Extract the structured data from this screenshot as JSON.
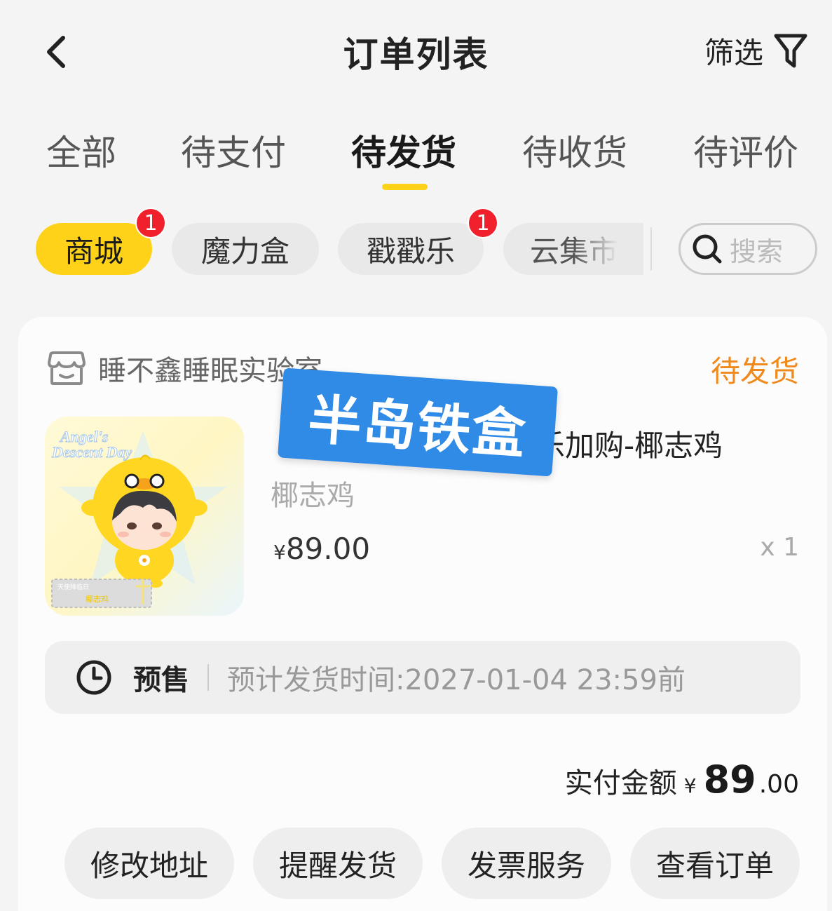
{
  "header": {
    "title": "订单列表",
    "filter_label": "筛选"
  },
  "tabs": [
    {
      "label": "全部"
    },
    {
      "label": "待支付"
    },
    {
      "label": "待发货"
    },
    {
      "label": "待收货"
    },
    {
      "label": "待评价"
    }
  ],
  "active_tab": "待发货",
  "subtabs": [
    {
      "label": "商城",
      "badge": "1"
    },
    {
      "label": "魔力盒"
    },
    {
      "label": "戳戳乐",
      "badge": "1"
    },
    {
      "label": "云集市"
    }
  ],
  "search": {
    "placeholder": "搜索"
  },
  "order": {
    "shop_name": "睡不鑫睡眠实验室",
    "status": "待发货",
    "product_title_tail": "乐加购-椰志鸡",
    "spec": "椰志鸡",
    "price_symbol": "¥",
    "price": "89.00",
    "quantity": "x 1",
    "presale_label": "预售",
    "presale_time": "预计发货时间:2027-01-04 23:59前",
    "total_label": "实付金额",
    "total_symbol": "¥",
    "total_int": "89",
    "total_dec": ".00",
    "image_text_1": "Angel's",
    "image_text_2": "Descent Day",
    "image_tag": "天使降临日",
    "image_name": "椰志鸡",
    "actions": [
      {
        "label": "修改地址"
      },
      {
        "label": "提醒发货"
      },
      {
        "label": "发票服务"
      },
      {
        "label": "查看订单"
      }
    ]
  },
  "watermark": "半岛铁盒",
  "colors": {
    "accent": "#ffd21a",
    "badge": "#f0212c",
    "status": "#f08a1d",
    "watermark": "#2f8be6"
  }
}
